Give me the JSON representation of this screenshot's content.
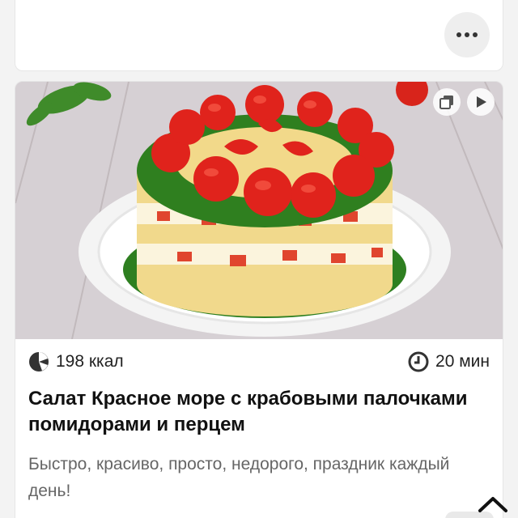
{
  "prev_card": {
    "more_icon": "more-horizontal-icon"
  },
  "recipe": {
    "image_alt": "salad-photo",
    "badges": [
      "gallery-icon",
      "play-icon"
    ],
    "calories": "198 ккал",
    "time": "20 мин",
    "title": "Салат Красное море с крабовыми палочками помидорами и перцем",
    "description": "Быстро, красиво, просто, недорого, праздник каждый день!"
  },
  "nav": {
    "scroll_up_icon": "chevron-up-icon"
  },
  "colors": {
    "tomato": "#e0231c",
    "dill": "#2d7a1f",
    "cheese": "#f2d98a",
    "plate": "#fafafa"
  }
}
